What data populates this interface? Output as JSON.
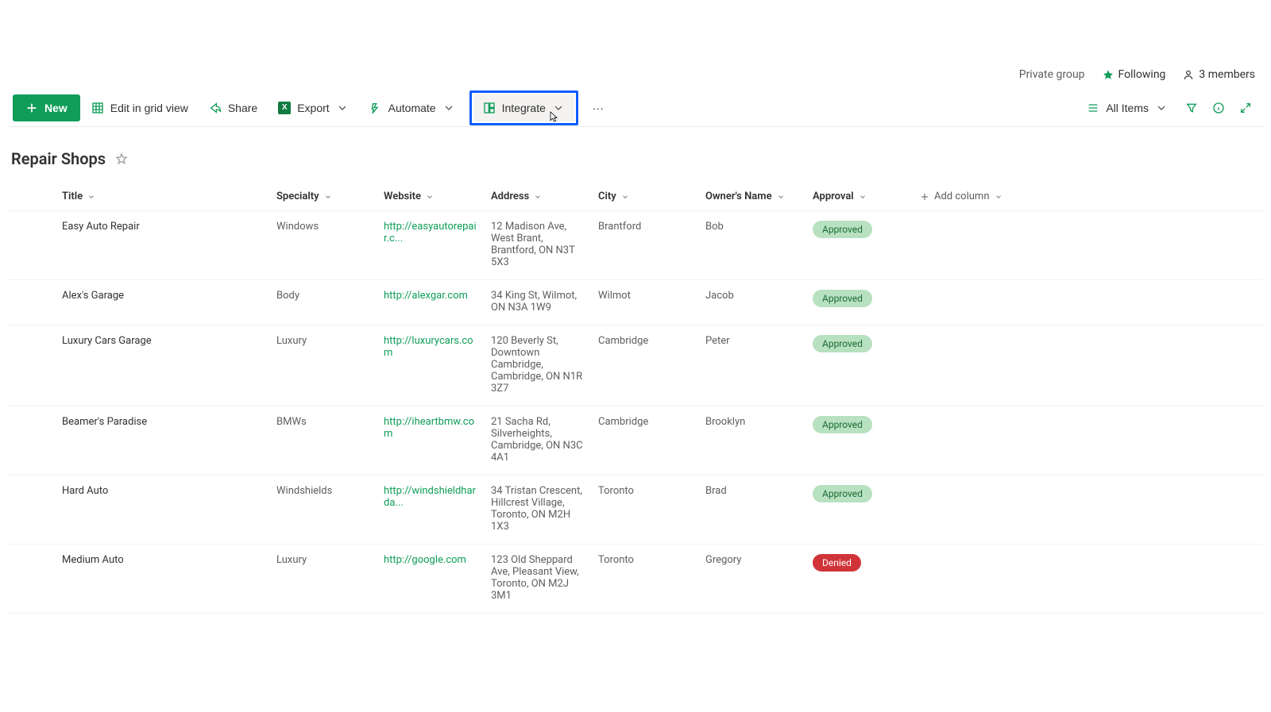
{
  "meta": {
    "group_privacy": "Private group",
    "following_label": "Following",
    "members_label": "3 members"
  },
  "commands": {
    "new": "New",
    "edit_grid": "Edit in grid view",
    "share": "Share",
    "export": "Export",
    "automate": "Automate",
    "integrate": "Integrate",
    "more": "···",
    "view_name": "All Items"
  },
  "list": {
    "title": "Repair Shops"
  },
  "columns": {
    "title": "Title",
    "specialty": "Specialty",
    "website": "Website",
    "address": "Address",
    "city": "City",
    "owner": "Owner's Name",
    "approval": "Approval",
    "addcol": "Add column"
  },
  "rows": [
    {
      "title": "Easy Auto Repair",
      "specialty": "Windows",
      "website": "http://easyautorepair.c...",
      "address": "12 Madison Ave, West Brant, Brantford, ON N3T 5X3",
      "city": "Brantford",
      "owner": "Bob",
      "approval": "Approved"
    },
    {
      "title": "Alex's Garage",
      "specialty": "Body",
      "website": "http://alexgar.com",
      "address": "34 King St, Wilmot, ON N3A 1W9",
      "city": "Wilmot",
      "owner": "Jacob",
      "approval": "Approved"
    },
    {
      "title": "Luxury Cars Garage",
      "specialty": "Luxury",
      "website": "http://luxurycars.com",
      "address": "120 Beverly St, Downtown Cambridge, Cambridge, ON N1R 3Z7",
      "city": "Cambridge",
      "owner": "Peter",
      "approval": "Approved"
    },
    {
      "title": "Beamer's Paradise",
      "specialty": "BMWs",
      "website": "http://iheartbmw.com",
      "address": "21 Sacha Rd, Silverheights, Cambridge, ON N3C 4A1",
      "city": "Cambridge",
      "owner": "Brooklyn",
      "approval": "Approved"
    },
    {
      "title": "Hard Auto",
      "specialty": "Windshields",
      "website": "http://windshieldharda...",
      "address": "34 Tristan Crescent, Hillcrest Village, Toronto, ON M2H 1X3",
      "city": "Toronto",
      "owner": "Brad",
      "approval": "Approved"
    },
    {
      "title": "Medium Auto",
      "specialty": "Luxury",
      "website": "http://google.com",
      "address": "123 Old Sheppard Ave, Pleasant View, Toronto, ON M2J 3M1",
      "city": "Toronto",
      "owner": "Gregory",
      "approval": "Denied"
    }
  ]
}
